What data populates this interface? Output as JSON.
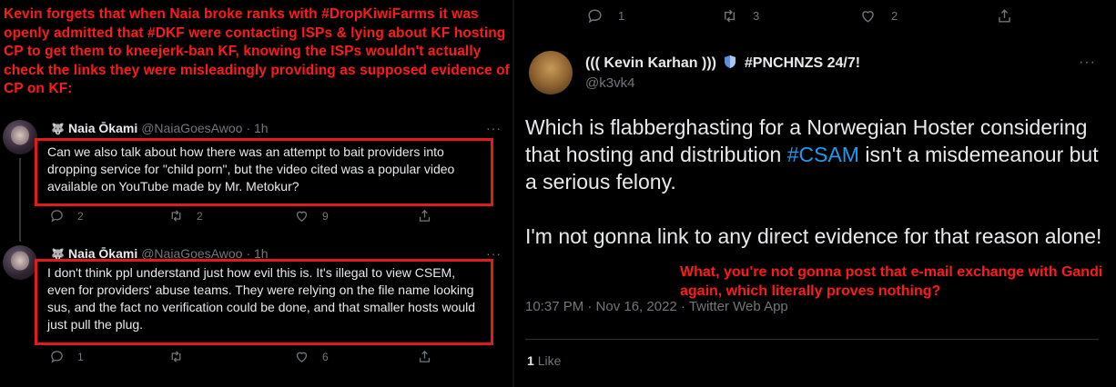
{
  "caption": "Kevin forgets that when Naia broke ranks with #DropKiwiFarms it was openly admitted that #DKF were contacting ISPs & lying about KF hosting CP to get them to kneejerk-ban KF, knowing the ISPs wouldn't actually check the links they were misleadingly providing as supposed evidence of CP on KF:",
  "tweets": [
    {
      "name": "Naia Ōkami",
      "handle": "@NaiaGoesAwoo",
      "time": "· 1h",
      "text": "Can we also talk about how there was an attempt to bait providers into dropping service for \"child porn\", but the video cited was a popular video available on YouTube made by Mr. Metokur?",
      "replies": "2",
      "retweets": "2",
      "likes": "9"
    },
    {
      "name": "Naia Ōkami",
      "handle": "@NaiaGoesAwoo",
      "time": "· 1h",
      "text": "I don't think ppl understand just how evil this is. It's illegal to view CSEM, even for providers' abuse teams. They were relying on the file name looking sus, and the fact no verification could be done, and that smaller hosts would just pull the plug.",
      "replies": "1",
      "retweets": "",
      "likes": "6"
    }
  ],
  "right": {
    "top_actions": {
      "replies": "1",
      "retweets": "3",
      "likes": "2"
    },
    "name_prefix": "((( Kevin Karhan )))",
    "name_suffix": "#PNCHNZS 24/7!",
    "handle": "@k3vk4",
    "para1_a": "Which is flabberghasting for a Norwegian Hoster considering that hosting and distribution ",
    "para1_tag": "#CSAM",
    "para1_b": " isn't a misdemeanour but a serious felony.",
    "para2": "I'm not gonna link to any direct evidence for that reason alone!",
    "timestamp": "10:37 PM · Nov 16, 2022 · Twitter Web App",
    "likes_count": "1",
    "likes_label": "Like",
    "overlay": "What, you're not gonna post that e-mail exchange with Gandi again, which literally proves nothing?"
  },
  "colors": {
    "annotation_red": "#ff1a1a",
    "box_red": "#e11b1b",
    "link_blue": "#1d9bf0"
  }
}
